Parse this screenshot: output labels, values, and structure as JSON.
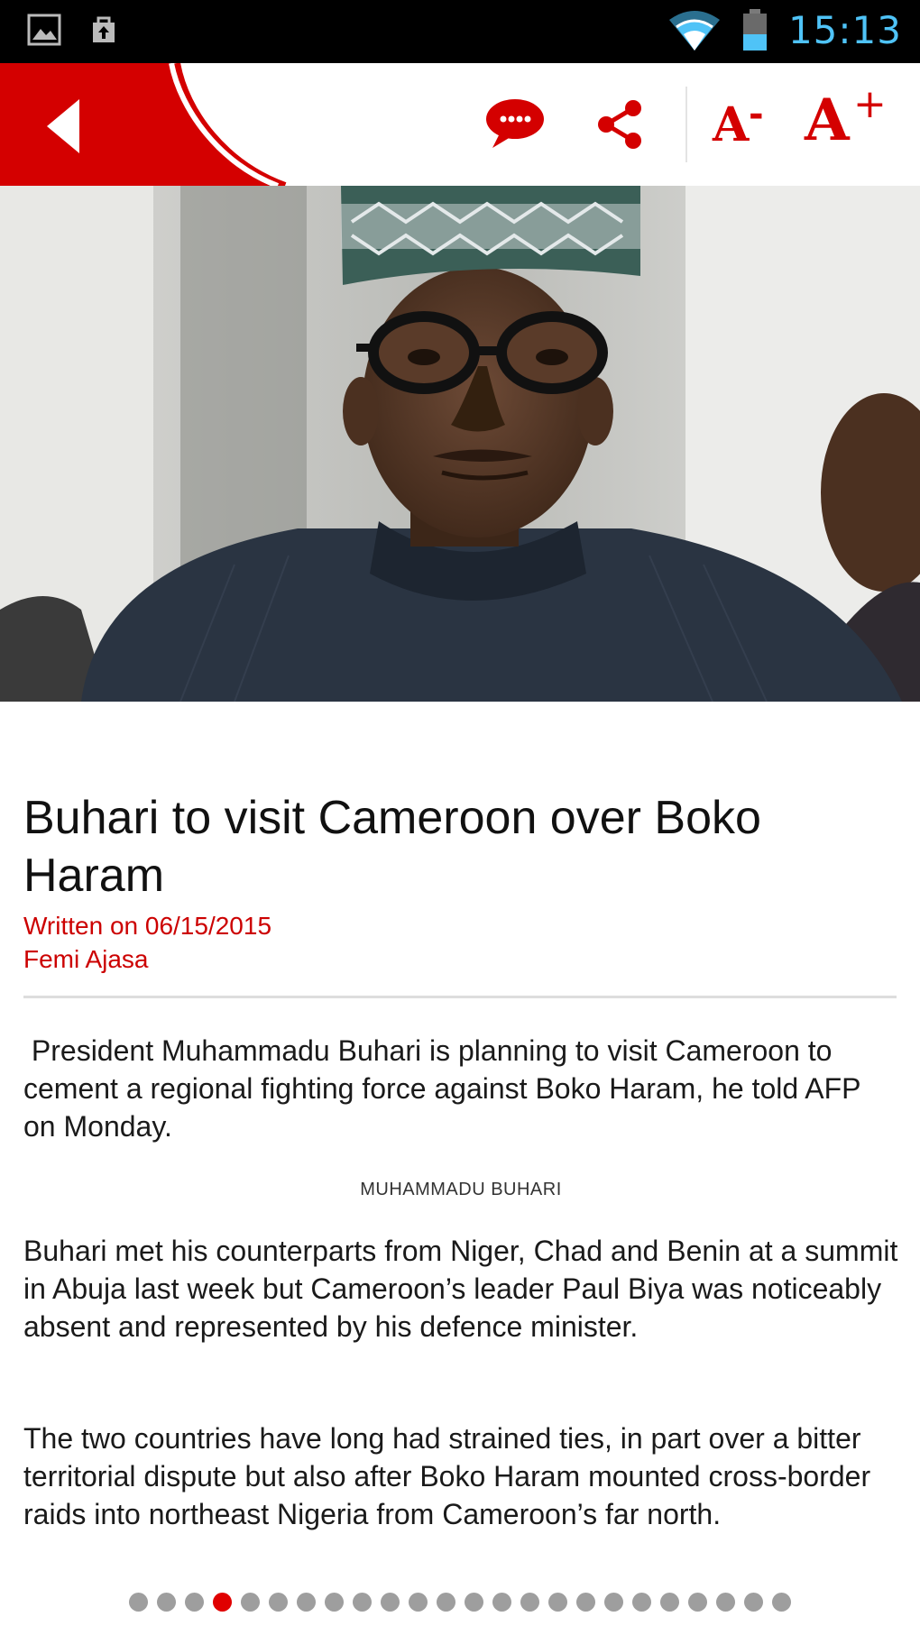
{
  "status_bar": {
    "time": "15:13",
    "left_icons": [
      "image-icon",
      "briefcase-upload-icon"
    ],
    "right_icons": [
      "wifi-icon",
      "battery-icon"
    ],
    "time_color": "#4fc3f7"
  },
  "toolbar": {
    "accent_color": "#d40000",
    "font_decrease_label": "A",
    "font_decrease_symbol": "-",
    "font_increase_label": "A",
    "font_increase_symbol": "+",
    "icons": [
      "back-arrow-icon",
      "comment-icon",
      "share-icon"
    ]
  },
  "hero_image": {
    "subject": "portrait photo"
  },
  "article": {
    "headline": "Buhari to visit Cameroon over Boko Haram",
    "written_on": "Written on 06/15/2015",
    "author": "Femi Ajasa",
    "paragraph_1": " President Muhammadu Buhari is planning to visit Cameroon to cement a regional fighting force against Boko Haram, he told AFP on Monday.",
    "caption": "MUHAMMADU BUHARI",
    "paragraph_2": "Buhari met his counterparts from Niger, Chad and Benin at a summit in Abuja last week but Cameroon’s leader Paul Biya was noticeably absent and represented by his defence minister.",
    "paragraph_3": "The two countries have long had strained ties, in part over a bitter territorial dispute but also after Boko Haram mounted cross-border raids into northeast Nigeria from Cameroon’s far north."
  },
  "pager": {
    "total": 24,
    "active_index": 3,
    "active_color": "#e00000",
    "inactive_color": "#9e9e9e"
  }
}
